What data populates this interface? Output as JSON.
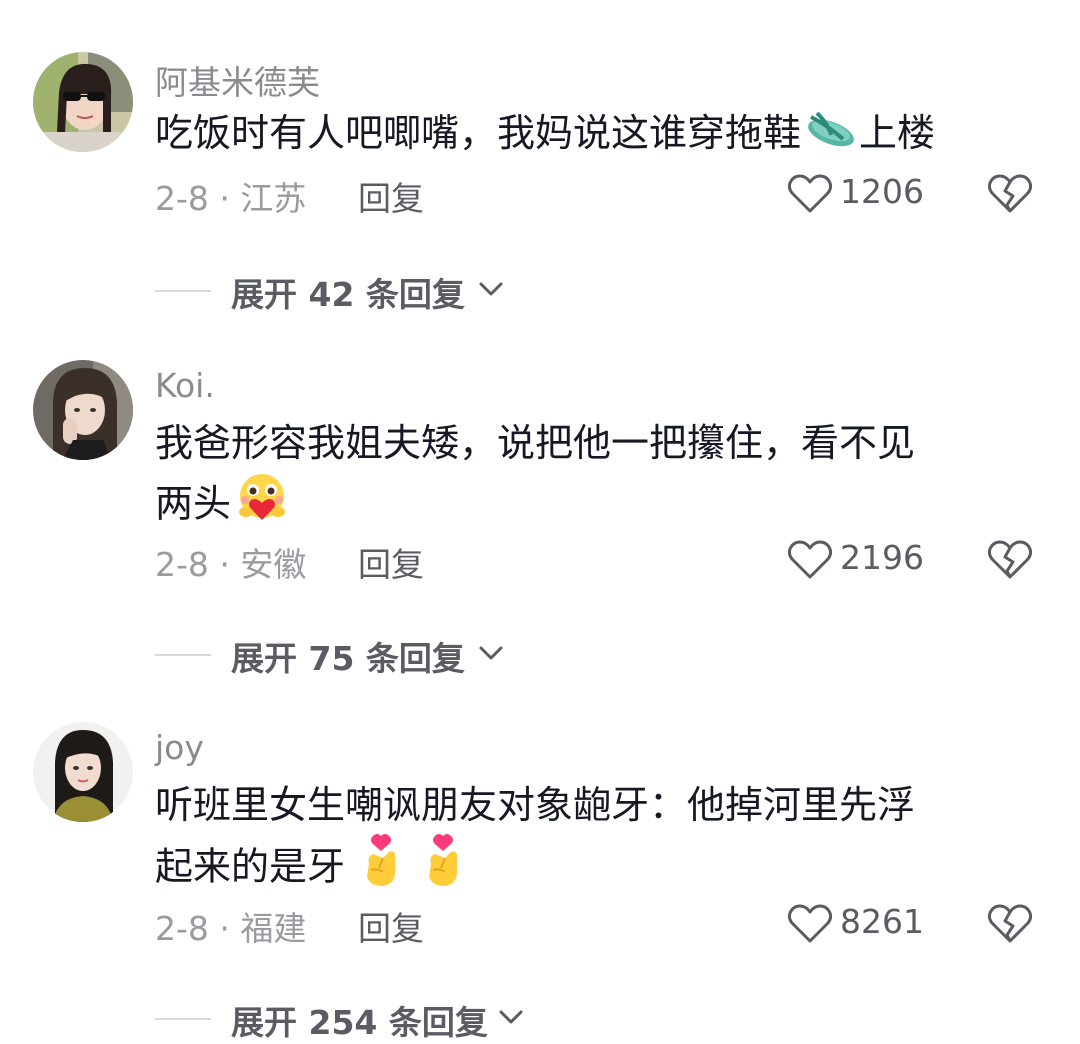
{
  "comments": [
    {
      "username": "阿基米德芙",
      "text_lines": [
        "吃饭时有人吧唧嘴，我妈说这谁穿拖鞋",
        "上楼"
      ],
      "emojis": [
        "flip-flop"
      ],
      "date_location": "2-8 · 江苏",
      "reply_label": "回复",
      "likes": "1206",
      "expand_label": "展开 42 条回复"
    },
    {
      "username": "Koi.",
      "text_lines": [
        "我爸形容我姐夫矮，说把他一把攥住，看不见",
        "两头"
      ],
      "emojis": [
        "hugging-heart-face"
      ],
      "date_location": "2-8 · 安徽",
      "reply_label": "回复",
      "likes": "2196",
      "expand_label": "展开 75 条回复"
    },
    {
      "username": "joy",
      "text_lines": [
        "听班里女生嘲讽朋友对象龅牙：他掉河里先浮",
        "起来的是牙"
      ],
      "emojis": [
        "finger-heart",
        "finger-heart"
      ],
      "date_location": "2-8 · 福建",
      "reply_label": "回复",
      "likes": "8261",
      "expand_label": "展开 254 条回复"
    }
  ],
  "colors": {
    "text": "#161823",
    "username": "#8a8b91",
    "meta": "#9a9ba1",
    "action": "#5b5c63"
  }
}
